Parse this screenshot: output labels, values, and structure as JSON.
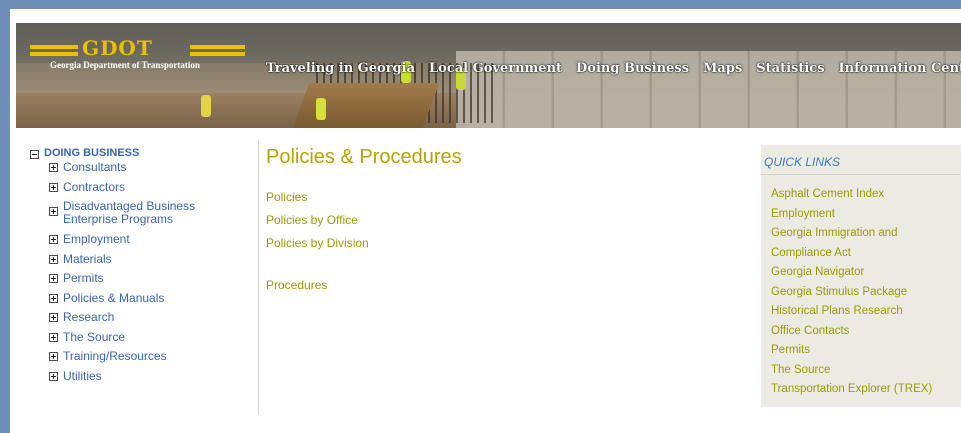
{
  "header": {
    "logo_text": "GDOT",
    "logo_subtitle": "Georgia Department of Transportation",
    "nav": [
      "Traveling in Georgia",
      "Local Government",
      "Doing Business",
      "Maps",
      "Statistics",
      "Information Center"
    ]
  },
  "sidebar": {
    "heading": "DOING BUSINESS",
    "items": [
      "Consultants",
      "Contractors",
      "Disadvantaged Business Enterprise Programs",
      "Employment",
      "Materials",
      "Permits",
      "Policies & Manuals",
      "Research",
      "The Source",
      "Training/Resources",
      "Utilities"
    ]
  },
  "main": {
    "title": "Policies & Procedures",
    "links": [
      "Policies",
      "Policies by Office",
      "Policies by Division"
    ],
    "procedures": "Procedures"
  },
  "quick_links": {
    "heading": "QUICK LINKS",
    "items": [
      "Asphalt Cement Index",
      "Employment",
      "Georgia Immigration and",
      "Compliance Act",
      "Georgia Navigator",
      "Georgia Stimulus Package",
      "Historical Plans Research",
      "Office Contacts",
      "Permits",
      "The Source",
      "Transportation Explorer (TREX)"
    ]
  },
  "colors": {
    "link_blue": "#3a65b0",
    "link_olive": "#9a9a00",
    "title_gold": "#b5a400",
    "logo_yellow": "#e8c200"
  },
  "icons": {
    "collapse": "minus-box-icon",
    "expand": "plus-box-icon"
  }
}
